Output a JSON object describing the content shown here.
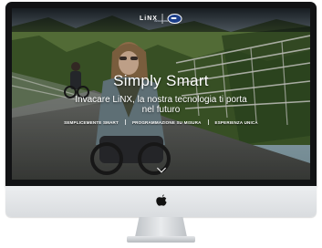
{
  "site": {
    "logo_text": "LiNX",
    "badge_text": "INVACARE"
  },
  "hero": {
    "title": "Simply Smart",
    "subtitle": "Invacare LiNX, la nostra tecnologia ti porta nel futuro"
  },
  "nav": {
    "items": [
      {
        "label": "SEMPLICEMENTE SMART"
      },
      {
        "label": "PROGRAMMAZIONE SU MISURA"
      },
      {
        "label": "ESPERIENZA UNICA"
      }
    ]
  },
  "icons": {
    "scroll": "chevron-down-icon",
    "brand": "apple-logo"
  },
  "colors": {
    "bezel": "#111214",
    "chin": "#e3e5e8",
    "badge": "#1d3f8a",
    "text": "#ffffff"
  }
}
